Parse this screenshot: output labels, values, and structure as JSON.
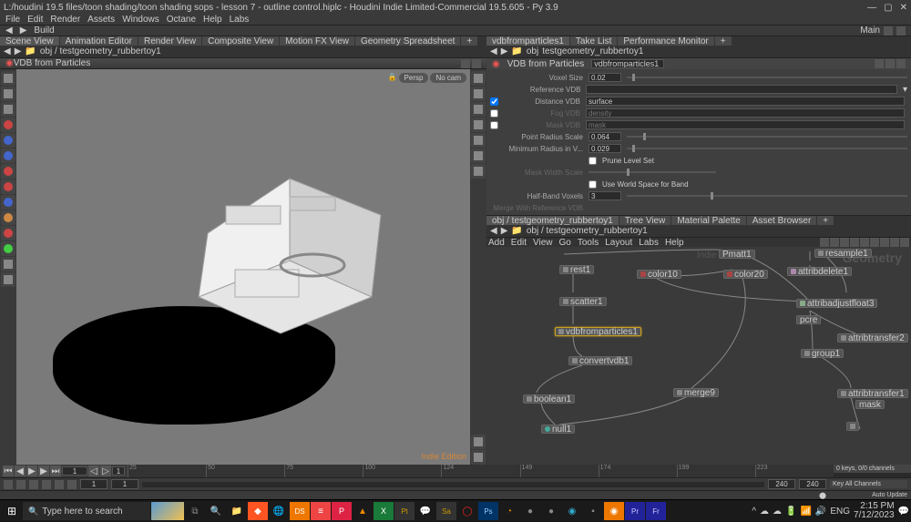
{
  "title": "L:/houdini 19.5 files/toon shading/toon shading sops - lesson 7 - outline control.hiplc - Houdini Indie Limited-Commercial 19.5.605 - Py 3.9",
  "menu": [
    "File",
    "Edit",
    "Render",
    "Assets",
    "Windows",
    "Octane",
    "Help",
    "Labs"
  ],
  "toolbar": {
    "build": "Build",
    "main": "Main"
  },
  "pane_left": {
    "tabs": [
      "Scene View",
      "Animation Editor",
      "Render View",
      "Composite View",
      "Motion FX View",
      "Geometry Spreadsheet"
    ],
    "path": "obj / testgeometry_rubbertoy1",
    "header": "VDB from Particles",
    "persp": "Persp",
    "nocam": "No cam",
    "watermark": "Indie Edition"
  },
  "pane_right_top": {
    "tabs": [
      "vdbfromparticles1",
      "Take List",
      "Performance Monitor"
    ],
    "path_prefix": "obj",
    "path": "testgeometry_rubbertoy1",
    "header_label": "VDB from Particles",
    "header_name": "vdbfromparticles1",
    "params": {
      "voxel_size": {
        "label": "Voxel Size",
        "value": "0.02"
      },
      "reference_vdb": {
        "label": "Reference VDB"
      },
      "distance_vdb": {
        "label": "Distance VDB",
        "value": "surface",
        "checked": true
      },
      "fog_vdb": {
        "label": "Fog VDB",
        "placeholder": "density"
      },
      "mask_vdb": {
        "label": "Mask VDB",
        "placeholder": "mask"
      },
      "point_radius": {
        "label": "Point Radius Scale",
        "value": "0.064"
      },
      "min_radius": {
        "label": "Minimum Radius in V...",
        "value": "0.029"
      },
      "prune_level": {
        "label": "Prune Level Set"
      },
      "mask_width": {
        "label": "Mask Width Scale"
      },
      "world_space": {
        "label": "Use World Space for Band"
      },
      "half_band": {
        "label": "Half-Band Voxels",
        "value": "3"
      },
      "merge_ref": {
        "label": "Merge With Reference VDB"
      }
    }
  },
  "network": {
    "tabs": [
      "obj / testgeometry_rubbertoy1",
      "Tree View",
      "Material Palette",
      "Asset Browser"
    ],
    "path": "obj / testgeometry_rubbertoy1",
    "menu": [
      "Add",
      "Edit",
      "View",
      "Go",
      "Tools",
      "Layout",
      "Labs",
      "Help"
    ],
    "watermark": "Geometry",
    "watermark2": "Indie Edition",
    "nodes": {
      "rest": "rest1",
      "color10": "color10",
      "color20": "color20",
      "attribdelete": "attribdelete1",
      "resample": "resample1",
      "scatter": "scatter1",
      "vdbfromparticles": "vdbfromparticles1",
      "adjfloat3": "attribadjustfloat3",
      "convertvdb": "convertvdb1",
      "attribtransfer2": "attribtransfer2",
      "group1": "group1",
      "boolean": "boolean1",
      "merge9": "merge9",
      "attribtransfer1": "attribtransfer1",
      "mask": "mask",
      "null1": "null1",
      "pmatt": "Pmatt1",
      "pcre": "pcre"
    }
  },
  "timeline": {
    "frame": "1",
    "start": "1",
    "end": "240",
    "range_end": "240",
    "frame_step": "1",
    "channels_label": "0 keys, 0/0 channels",
    "key_all": "Key All Channels",
    "auto_update": "Auto Update"
  },
  "taskbar": {
    "search_placeholder": "Type here to search",
    "lang": "ENG",
    "time": "2:15 PM",
    "date": "7/12/2023"
  }
}
